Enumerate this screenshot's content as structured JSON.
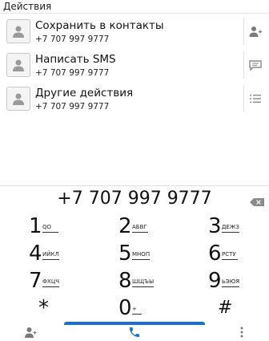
{
  "header": {
    "title": "Действия"
  },
  "actions": [
    {
      "title": "Сохранить в контакты",
      "number": "+7 707 997 9777",
      "icon": "add-contact-icon"
    },
    {
      "title": "Написать SMS",
      "number": "+7 707 997 9777",
      "icon": "message-icon"
    },
    {
      "title": "Другие действия",
      "number": "+7 707 997 9777",
      "icon": "list-icon"
    }
  ],
  "dialed_number": "+7 707 997 9777",
  "keypad": [
    {
      "digit": "1",
      "letters": "QO"
    },
    {
      "digit": "2",
      "letters": "АБВГ"
    },
    {
      "digit": "3",
      "letters": "ДЕЖЗ"
    },
    {
      "digit": "4",
      "letters": "ИЙКЛ"
    },
    {
      "digit": "5",
      "letters": "МНОП"
    },
    {
      "digit": "6",
      "letters": "РСТУ"
    },
    {
      "digit": "7",
      "letters": "ФХЦЧ"
    },
    {
      "digit": "8",
      "letters": "ШЩЪЫ"
    },
    {
      "digit": "9",
      "letters": "ЬЭЮЯ"
    },
    {
      "digit": "*",
      "letters": ""
    },
    {
      "digit": "0",
      "letters": "+"
    },
    {
      "digit": "#",
      "letters": ""
    }
  ],
  "bottom_bar": {
    "left_icon": "contacts-icon",
    "center_icon": "phone-icon",
    "right_icon": "more-vert-icon"
  },
  "colors": {
    "accent": "#1b6fd2",
    "divider": "#e0e0e0"
  }
}
